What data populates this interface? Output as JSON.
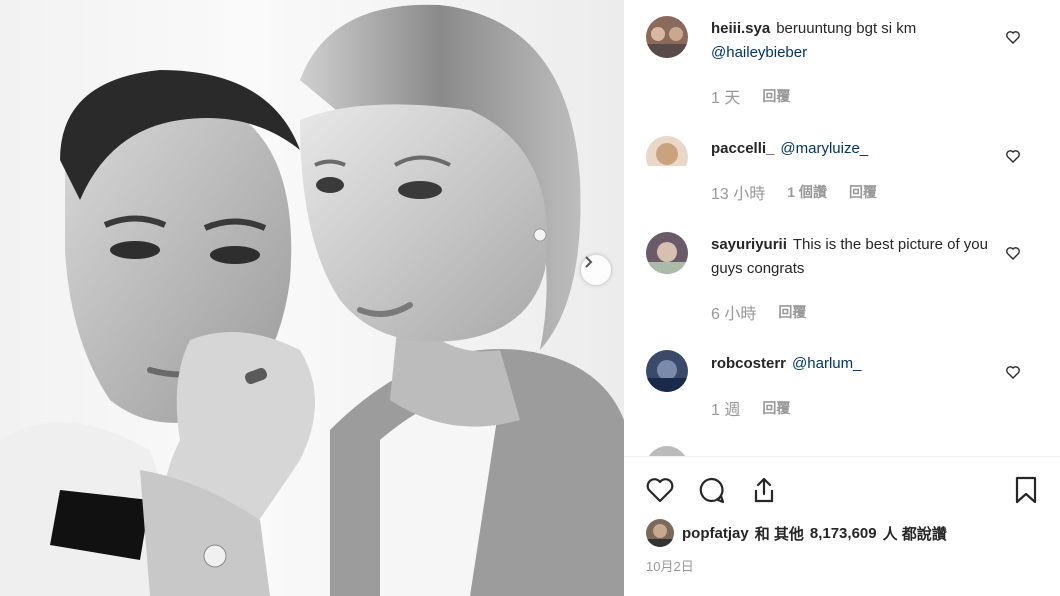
{
  "comments": [
    {
      "user": "heiii.sya",
      "text": "beruuntung bgt si km",
      "mention": "@haileybieber",
      "time": "1 天",
      "actions": [
        "回覆"
      ]
    },
    {
      "user": "paccelli_",
      "text": "",
      "mention": "@maryluize_",
      "time": "13 小時",
      "actions": [
        "1 個讚",
        "回覆"
      ]
    },
    {
      "user": "sayuriyurii",
      "text": "This is the best picture of you guys congrats",
      "mention": "",
      "time": "6 小時",
      "actions": [
        "回覆"
      ]
    },
    {
      "user": "robcosterr",
      "text": "",
      "mention": "@harlum_",
      "time": "1 週",
      "actions": [
        "回覆"
      ]
    }
  ],
  "likes": {
    "user": "popfatjay",
    "connector": "和 其他",
    "count": "8,173,609",
    "suffix": "人 都說讚"
  },
  "date": "10月2日",
  "icons": {
    "like": "heart-icon",
    "comment": "comment-bubble-icon",
    "share": "share-icon",
    "save": "bookmark-icon",
    "next": "chevron-right-icon"
  },
  "colors": {
    "text": "#262626",
    "muted": "#999999",
    "mention": "#003569",
    "divider": "#efefef"
  }
}
